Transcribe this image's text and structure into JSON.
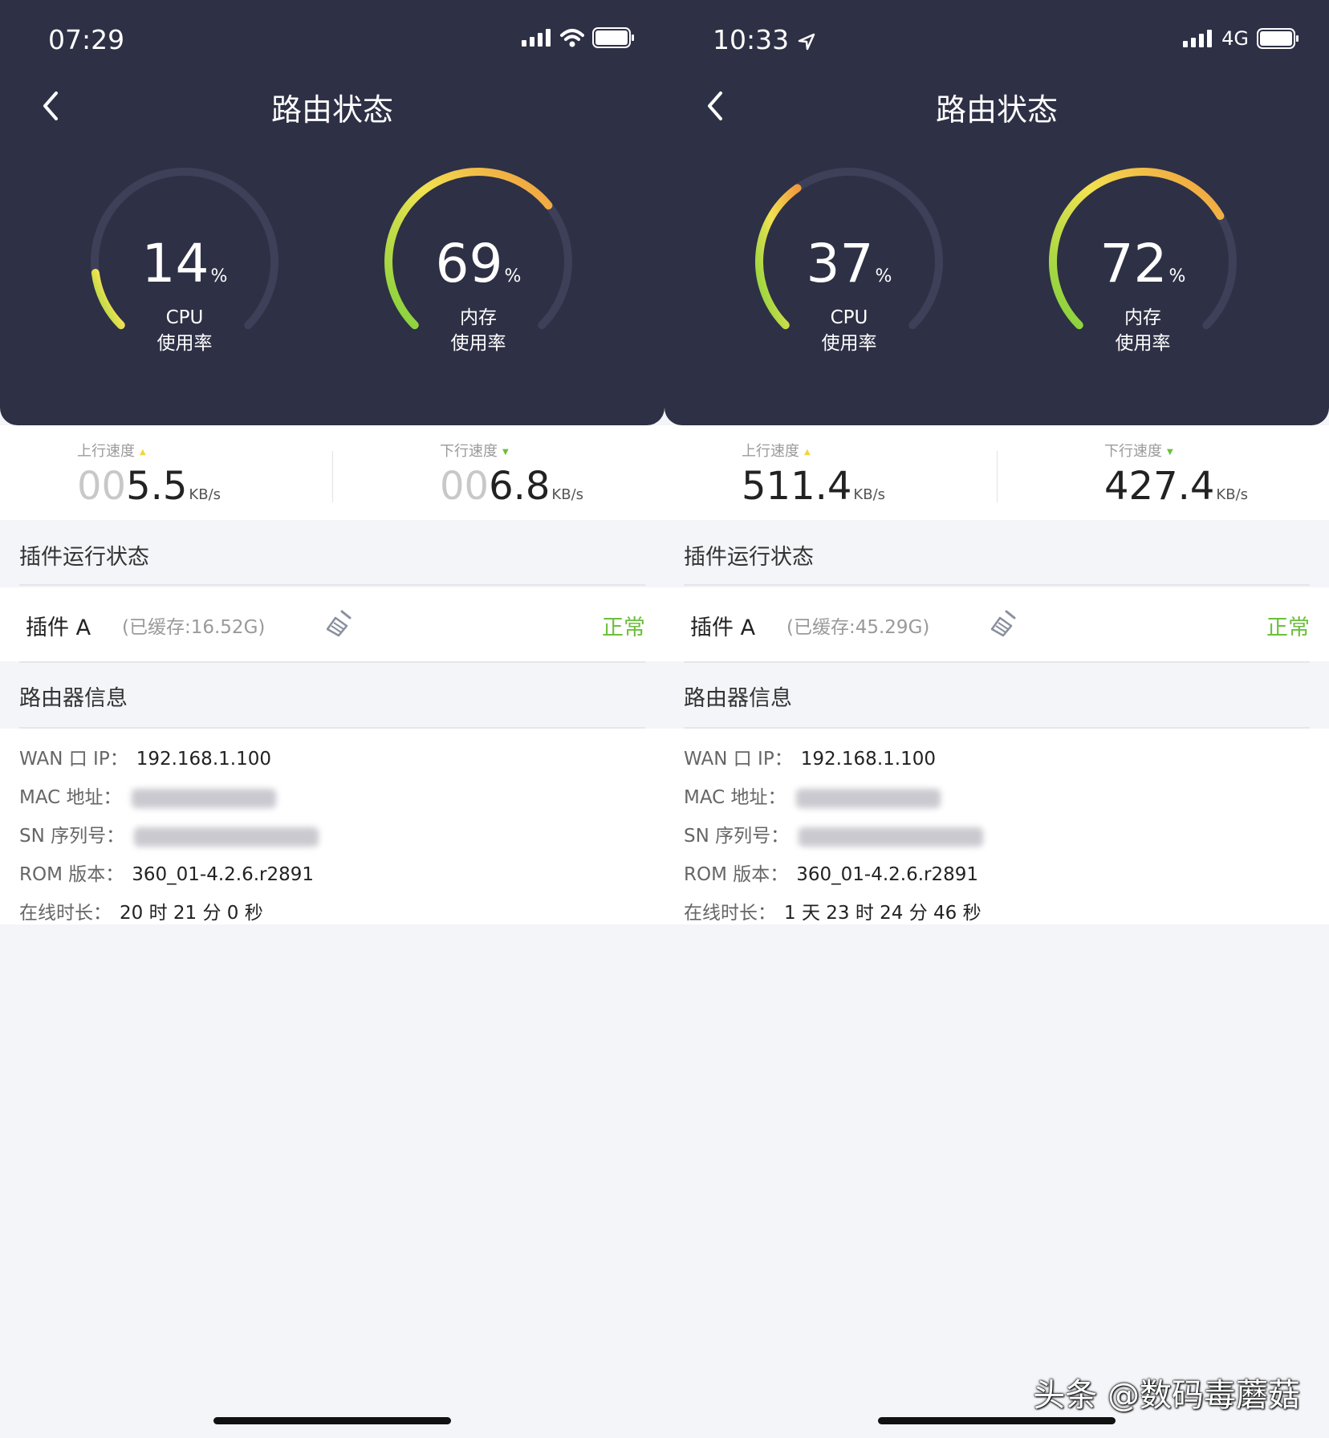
{
  "colors": {
    "header_bg": "#2e3045",
    "page_bg": "#f4f5f9",
    "status_ok": "#6cbf3c",
    "gauge_start": "#7fd13b",
    "gauge_mid": "#f1e251",
    "gauge_end": "#f19a3e"
  },
  "watermark": "头条 @数码毒蘑菇",
  "screens": [
    {
      "time": "07:29",
      "network": "",
      "title": "路由状态",
      "cpu": {
        "value": "14",
        "unit": "%",
        "label1": "CPU",
        "label2": "使用率",
        "fraction": 0.14
      },
      "mem": {
        "value": "69",
        "unit": "%",
        "label1": "内存",
        "label2": "使用率",
        "fraction": 0.69
      },
      "up": {
        "label": "上行速度",
        "lead": "00",
        "value": "5.5",
        "unit": "KB/s"
      },
      "down": {
        "label": "下行速度",
        "lead": "00",
        "value": "6.8",
        "unit": "KB/s"
      },
      "plugin_section": "插件运行状态",
      "plugin": {
        "name": "插件 A",
        "cache": "(已缓存:16.52G)",
        "status": "正常"
      },
      "router_section": "路由器信息",
      "wan": {
        "label": "WAN 口 IP：",
        "value": "192.168.1.100"
      },
      "mac": {
        "label": "MAC 地址："
      },
      "sn": {
        "label": "SN 序列号："
      },
      "rom": {
        "label": "ROM 版本：",
        "value": "360_01-4.2.6.r2891"
      },
      "uptime": {
        "label": "在线时长：",
        "value": "20 时 21 分 0 秒"
      }
    },
    {
      "time": "10:33",
      "network": "4G",
      "title": "路由状态",
      "cpu": {
        "value": "37",
        "unit": "%",
        "label1": "CPU",
        "label2": "使用率",
        "fraction": 0.37
      },
      "mem": {
        "value": "72",
        "unit": "%",
        "label1": "内存",
        "label2": "使用率",
        "fraction": 0.72
      },
      "up": {
        "label": "上行速度",
        "lead": "",
        "value": "511.4",
        "unit": "KB/s"
      },
      "down": {
        "label": "下行速度",
        "lead": "",
        "value": "427.4",
        "unit": "KB/s"
      },
      "plugin_section": "插件运行状态",
      "plugin": {
        "name": "插件 A",
        "cache": "(已缓存:45.29G)",
        "status": "正常"
      },
      "router_section": "路由器信息",
      "wan": {
        "label": "WAN 口 IP：",
        "value": "192.168.1.100"
      },
      "mac": {
        "label": "MAC 地址："
      },
      "sn": {
        "label": "SN 序列号："
      },
      "rom": {
        "label": "ROM 版本：",
        "value": "360_01-4.2.6.r2891"
      },
      "uptime": {
        "label": "在线时长：",
        "value": "1 天 23 时 24 分 46 秒"
      }
    }
  ]
}
